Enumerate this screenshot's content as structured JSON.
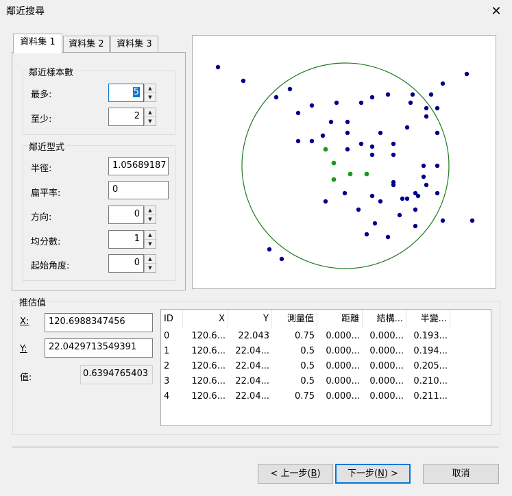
{
  "window": {
    "title": "鄰近搜尋"
  },
  "tabs": [
    {
      "label": "資料集 1",
      "active": true
    },
    {
      "label": "資料集 2",
      "active": false
    },
    {
      "label": "資料集 3",
      "active": false
    }
  ],
  "neighbors": {
    "group_label": "鄰近樣本數",
    "max_label": "最多:",
    "max_value": "5",
    "min_label": "至少:",
    "min_value": "2"
  },
  "sector": {
    "group_label": "鄰近型式",
    "radius_label": "半徑:",
    "radius_value": "1.05689187",
    "flat_label": "扁平率:",
    "flat_value": "0",
    "direction_label": "方向:",
    "direction_value": "0",
    "divisions_label": "均分數:",
    "divisions_value": "1",
    "start_angle_label": "起始角度:",
    "start_angle_value": "0"
  },
  "estimate": {
    "group_label": "推估值",
    "x_label": "X:",
    "x_value": "120.6988347456",
    "y_label": "Y:",
    "y_value": "22.0429713549391",
    "value_label": "值:",
    "value_value": "0.6394765403"
  },
  "table": {
    "columns": [
      "ID",
      "X",
      "Y",
      "測量值",
      "距離",
      "結構...",
      "半變..."
    ],
    "rows": [
      [
        "0",
        "120.6...",
        "22.043",
        "0.75",
        "0.000...",
        "0.000...",
        "0.193..."
      ],
      [
        "1",
        "120.6...",
        "22.04...",
        "0.5",
        "0.000...",
        "0.000...",
        "0.194..."
      ],
      [
        "2",
        "120.6...",
        "22.04...",
        "0.5",
        "0.000...",
        "0.000...",
        "0.205..."
      ],
      [
        "3",
        "120.6...",
        "22.04...",
        "0.5",
        "0.000...",
        "0.000...",
        "0.210..."
      ],
      [
        "4",
        "120.6...",
        "22.04...",
        "0.75",
        "0.000...",
        "0.000...",
        "0.211..."
      ]
    ]
  },
  "buttons": {
    "back_prefix": "< 上一步(",
    "back_key": "B",
    "back_suffix": ")",
    "next_prefix": "下一步(",
    "next_key": "N",
    "next_suffix": ") >",
    "cancel": "取消"
  },
  "colors": {
    "sample_point": "#00008b",
    "neighbor_point": "#1a9b1a",
    "search_circle": "#1a7a1a"
  }
}
